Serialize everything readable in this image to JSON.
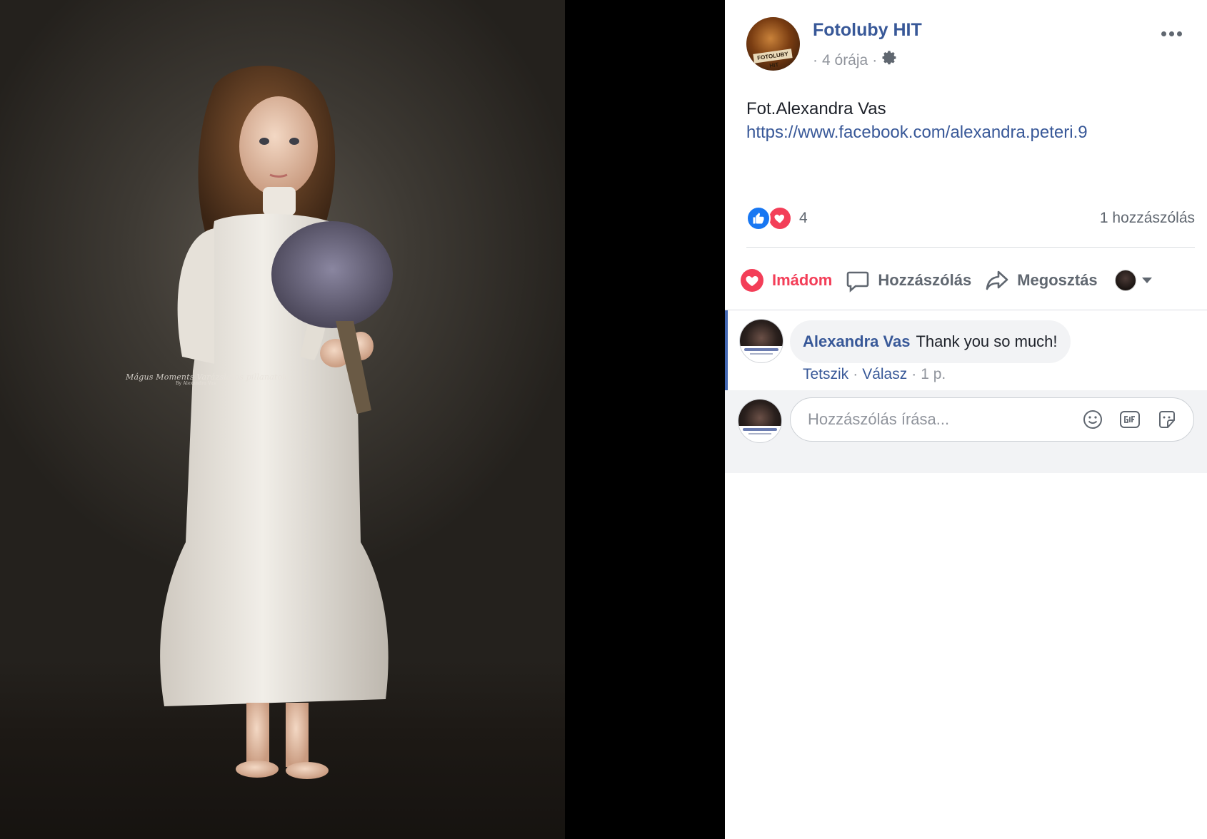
{
  "photo": {
    "watermark": "Mágus Moments Varázslatos pillanatok",
    "watermark_sub": "By Alexandra Vas"
  },
  "post": {
    "page_name": "Fotoluby HIT",
    "avatar_label": "FOTOLUBY HIT",
    "time": "4 órája",
    "separator": "·",
    "text_line": "Fot.Alexandra Vas",
    "link": "https://www.facebook.com/alexandra.peteri.9",
    "icons": {
      "more": "more-dots-icon",
      "audience": "gear-icon"
    }
  },
  "reactions": {
    "count": "4",
    "comments_count": "1 hozzászólás",
    "types": [
      "like",
      "love"
    ],
    "colors": {
      "like": "#1877f2",
      "love": "#f33e58"
    }
  },
  "actions": {
    "love_label": "Imádom",
    "comment_label": "Hozzászólás",
    "share_label": "Megosztás"
  },
  "comment": {
    "author": "Alexandra Vas",
    "text": "Thank you so much!",
    "like_label": "Tetszik",
    "reply_label": "Válasz",
    "separator": "·",
    "time": "1 p."
  },
  "composer": {
    "placeholder": "Hozzászólás írása...",
    "tools": [
      "emoji-icon",
      "gif-icon",
      "sticker-icon"
    ]
  },
  "colors": {
    "link": "#385898",
    "secondary_text": "#90949c",
    "love": "#f33e58",
    "comment_border": "#4267b2"
  }
}
